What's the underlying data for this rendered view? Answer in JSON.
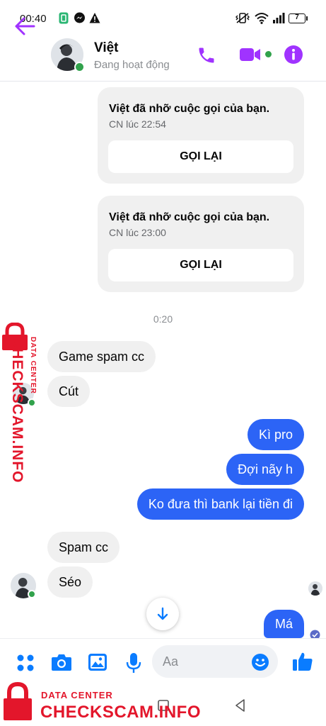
{
  "status_bar": {
    "time": "00:40",
    "battery": "7"
  },
  "contact": {
    "name": "Việt",
    "status": "Đang hoạt động"
  },
  "call_cards": [
    {
      "text": "Việt đã nhỡ cuộc gọi của bạn.",
      "time": "CN lúc 22:54",
      "button": "GỌI LẠI"
    },
    {
      "text": "Việt đã nhỡ cuộc gọi của bạn.",
      "time": "CN lúc 23:00",
      "button": "GỌI LẠI"
    }
  ],
  "timestamp": "0:20",
  "messages": [
    {
      "side": "received",
      "text": "Game spam cc"
    },
    {
      "side": "received",
      "text": "Cút"
    },
    {
      "side": "sent",
      "text": "Kì pro"
    },
    {
      "side": "sent",
      "text": "Đợi nãy h"
    },
    {
      "side": "sent",
      "text": "Ko đưa thì bank lại tiền đi"
    },
    {
      "side": "received",
      "text": "Spam cc"
    },
    {
      "side": "received",
      "text": "Séo"
    },
    {
      "side": "sent",
      "text": "Má"
    }
  ],
  "composer": {
    "placeholder": "Aa"
  },
  "watermark": {
    "top": "DATA CENTER",
    "main": "CHECKSCAM.INFO"
  },
  "colors": {
    "accent": "#a033ff",
    "sent_bubble": "#2c64f6",
    "composer_icons": "#0a7cff",
    "watermark": "#e3162b",
    "online": "#31a24c"
  },
  "icons": [
    "back-arrow-icon",
    "phone-icon",
    "video-call-icon",
    "info-icon",
    "apps-icon",
    "camera-icon",
    "gallery-icon",
    "mic-icon",
    "emoji-icon",
    "like-icon",
    "scroll-down-icon"
  ]
}
